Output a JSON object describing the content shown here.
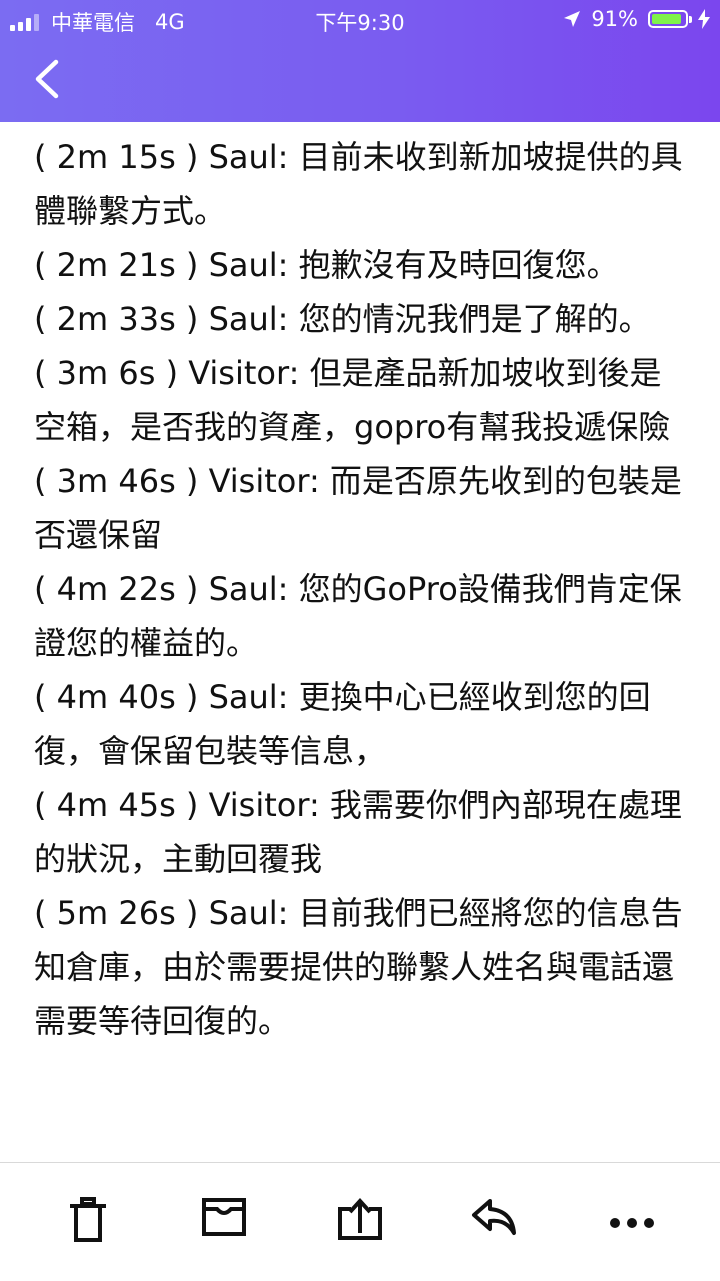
{
  "status_bar": {
    "carrier": "中華電信",
    "network": "4G",
    "time": "下午9:30",
    "battery_percent": "91%",
    "battery_level": 0.91
  },
  "header": {
    "back_icon": "chevron-left-icon"
  },
  "transcript": [
    "( 2m 15s ) Saul: 目前未收到新加坡提供的具體聯繫方式。",
    "( 2m 21s ) Saul: 抱歉沒有及時回復您。",
    "( 2m 33s ) Saul: 您的情況我們是了解的。",
    "( 3m 6s ) Visitor: 但是產品新加坡收到後是空箱，是否我的資產，gopro有幫我投遞保險",
    "( 3m 46s ) Visitor: 而是否原先收到的包裝是否還保留",
    "( 4m 22s ) Saul: 您的GoPro設備我們肯定保證您的權益的。",
    "( 4m 40s ) Saul: 更換中心已經收到您的回復，會保留包裝等信息，",
    "( 4m 45s ) Visitor: 我需要你們內部現在處理的狀況，主動回覆我",
    "( 5m 26s ) Saul: 目前我們已經將您的信息告知倉庫，由於需要提供的聯繫人姓名與電話還需要等待回復的。"
  ],
  "toolbar": {
    "items": [
      "trash-icon",
      "archive-icon",
      "move-to-folder-icon",
      "reply-icon",
      "more-icon"
    ]
  },
  "colors": {
    "header_gradient_start": "#7b6cf2",
    "header_gradient_end": "#7b46ee",
    "battery_fill": "#7ff24a",
    "toolbar_icon": "#111111"
  }
}
